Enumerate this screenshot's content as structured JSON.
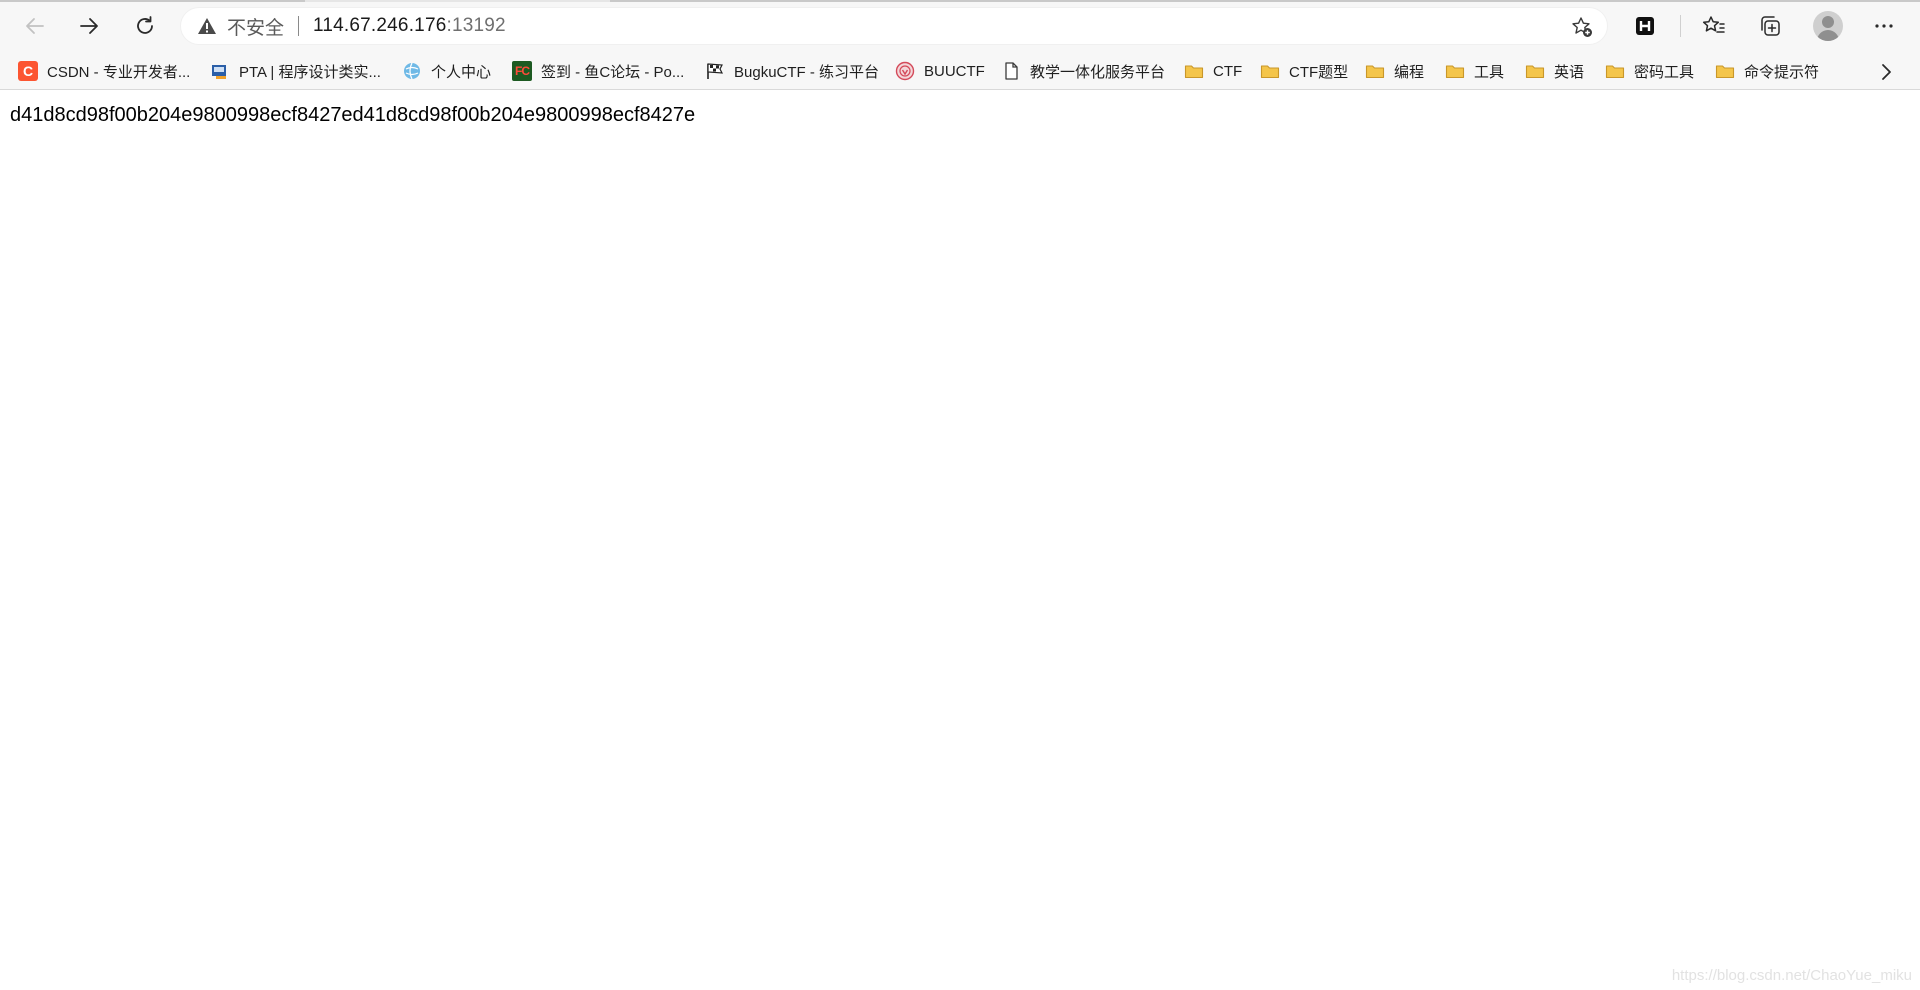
{
  "toolbar": {
    "insecure_label": "不安全",
    "url_host": "114.67.246.176",
    "url_port": ":13192"
  },
  "bookmarks": [
    {
      "label": "CSDN - 专业开发者...",
      "icon": "csdn-icon",
      "icon_text": "C"
    },
    {
      "label": "PTA | 程序设计类实...",
      "icon": "pta-icon"
    },
    {
      "label": "个人中心",
      "icon": "globe-icon"
    },
    {
      "label": "签到 - 鱼C论坛 - Po...",
      "icon": "fishc-icon",
      "icon_text": "FC"
    },
    {
      "label": "BugkuCTF - 练习平台",
      "icon": "checkered-flag-icon"
    },
    {
      "label": "BUUCTF",
      "icon": "buuctf-icon"
    },
    {
      "label": "教学一体化服务平台",
      "icon": "page-icon"
    },
    {
      "label": "CTF",
      "icon": "folder-icon"
    },
    {
      "label": "CTF题型",
      "icon": "folder-icon"
    },
    {
      "label": "编程",
      "icon": "folder-icon"
    },
    {
      "label": "工具",
      "icon": "folder-icon"
    },
    {
      "label": "英语",
      "icon": "folder-icon"
    },
    {
      "label": "密码工具",
      "icon": "folder-icon"
    },
    {
      "label": "命令提示符",
      "icon": "folder-icon"
    }
  ],
  "page": {
    "body_text": "d41d8cd98f00b204e9800998ecf8427ed41d8cd98f00b204e9800998ecf8427e"
  },
  "watermark": "https://blog.csdn.net/ChaoYue_miku",
  "colors": {
    "toolbar_bg": "#f7f7f7",
    "page_bg": "#ffffff",
    "folder": "#f4c54a",
    "csdn": "#fc5531"
  }
}
